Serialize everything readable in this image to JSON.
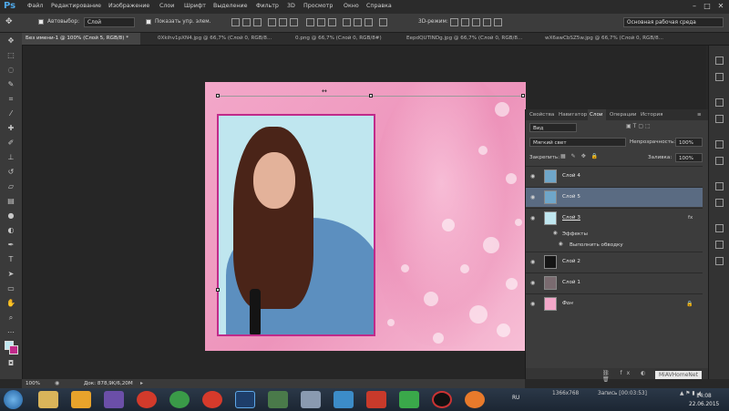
{
  "app": {
    "logo": "Ps"
  },
  "menu": [
    "Файл",
    "Редактирование",
    "Изображение",
    "Слои",
    "Шрифт",
    "Выделение",
    "Фильтр",
    "3D",
    "Просмотр",
    "Окно",
    "Справка"
  ],
  "options": {
    "autoselect_label": "Автовыбор:",
    "autoselect_value": "Слой",
    "show_controls_label": "Показать упр. элем.",
    "mode_3d": "3D-режим:",
    "workspace": "Основная рабочая среда"
  },
  "tabs": [
    "Без имени-1 @ 100% (Слой 5, RGB/8) *",
    "0Xkihv1pXN4.jpg @ 66,7% (Слой 0, RGB/8...",
    "0.png @ 66,7% (Слой 0, RGB/8#)",
    "EepdQUTINDg.jpg @ 66,7% (Слой 0, RGB/8...",
    "wX6awCbSZ5w.jpg @ 66,7% (Слой 0, RGB/8..."
  ],
  "status": {
    "zoom": "100%",
    "doc_info": "Док: 878,9K/6,20M"
  },
  "panel": {
    "tabs": [
      "Свойства",
      "Навигатор",
      "Слои",
      "Операции",
      "История"
    ],
    "active_tab": "Слои",
    "filter_kind": "Вид",
    "blend_mode": "Мягкий свет",
    "opacity_label": "Непрозрачность:",
    "opacity_value": "100%",
    "lock_label": "Закрепить:",
    "fill_label": "Заливка:",
    "fill_value": "100%",
    "layers": [
      {
        "name": "Слой 4",
        "selected": false
      },
      {
        "name": "Слой 5",
        "selected": true
      },
      {
        "name": "Слой 3",
        "selected": false,
        "fx": "fx"
      },
      {
        "name": "Слой 2",
        "selected": false
      },
      {
        "name": "Слой 1",
        "selected": false
      },
      {
        "name": "Фон",
        "selected": false
      }
    ],
    "effects_label": "Эффекты",
    "stroke_label": "Выполнить обводку"
  },
  "watermark": "MiAVHomeNet",
  "taskbar": {
    "lang": "RU",
    "resolution": "1366x768",
    "recording": "Запись [00:03:53]",
    "time": "14:08",
    "date": "22.06.2015"
  },
  "colors": {
    "accent_magenta": "#c02a8a",
    "selected_layer": "#5a6b82"
  }
}
